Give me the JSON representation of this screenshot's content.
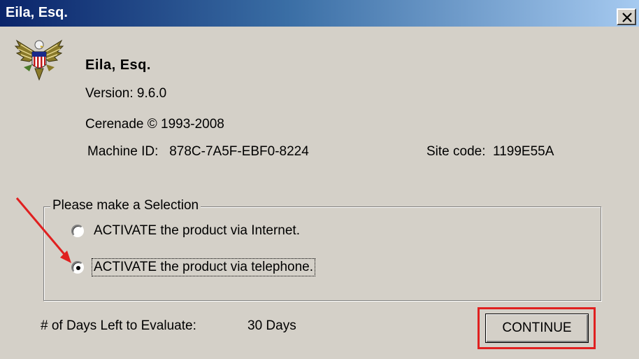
{
  "window": {
    "title": "Eila, Esq.",
    "close_label": "close"
  },
  "product": {
    "name": "Eila, Esq.",
    "version": "Version: 9.6.0",
    "copyright": "Cerenade © 1993-2008",
    "machine_id": "Machine ID:   878C-7A5F-EBF0-8224",
    "site_code": "Site code:  1199E55A",
    "logo_icon": "eagle-seal-icon"
  },
  "selection": {
    "group_label": "Please make a Selection",
    "options": [
      {
        "label": "ACTIVATE the product via Internet.",
        "selected": false
      },
      {
        "label": "ACTIVATE the product via telephone.",
        "selected": true
      }
    ]
  },
  "evaluation": {
    "days_label": "# of Days Left to Evaluate:",
    "days_value": "30 Days"
  },
  "actions": {
    "continue_label": "CONTINUE"
  },
  "colors": {
    "dialog_bg": "#d4d0c8",
    "titlebar_start": "#0a246a",
    "titlebar_end": "#a6caf0",
    "annotation_red": "#e02020"
  }
}
